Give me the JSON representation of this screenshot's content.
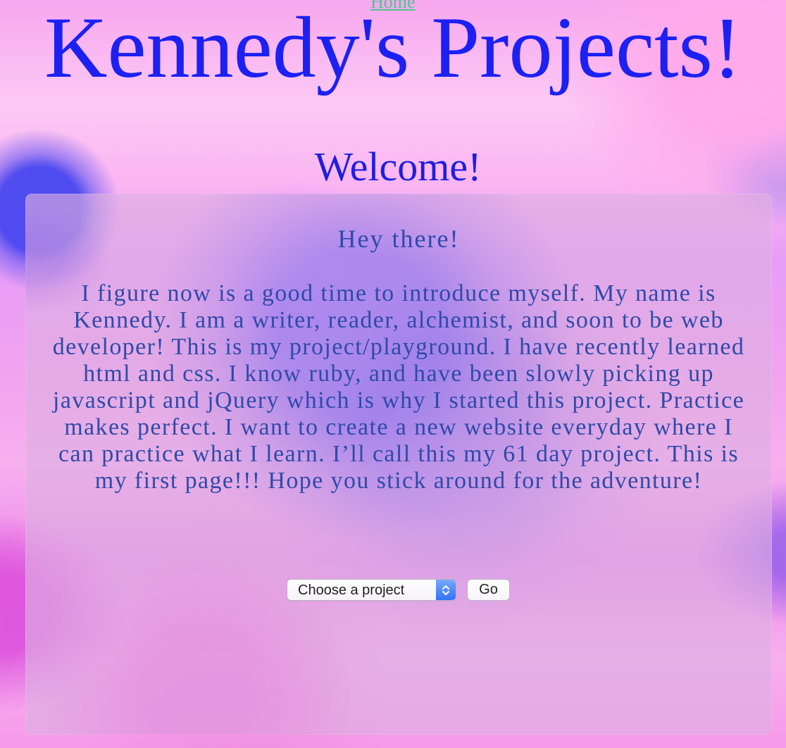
{
  "nav": {
    "home_label": "Home"
  },
  "header": {
    "title": "Kennedy's Projects!",
    "welcome": "Welcome!"
  },
  "content": {
    "heading": "Hey there!",
    "intro": "I figure now is a good time to introduce myself. My name is Kennedy. I am a writer, reader, alchemist, and soon to be web developer! This is my project/playground. I have recently learned html and css. I know ruby, and have been slowly picking up javascript and jQuery which is why I started this project. Practice makes perfect. I want to create a new website everyday where I can practice what I learn. I’ll call this my 61 day project. This is my first page!!! Hope you stick around for the adventure!",
    "project_select": {
      "selected": "Choose a project"
    },
    "go_button": "Go"
  },
  "colors": {
    "title": "#1c20f3",
    "body_text": "#2f4aa8",
    "home_link": "#49c88a",
    "select_accent": "#2f74f5"
  },
  "icons": {
    "select_arrow": "chevron-up-down-icon"
  }
}
